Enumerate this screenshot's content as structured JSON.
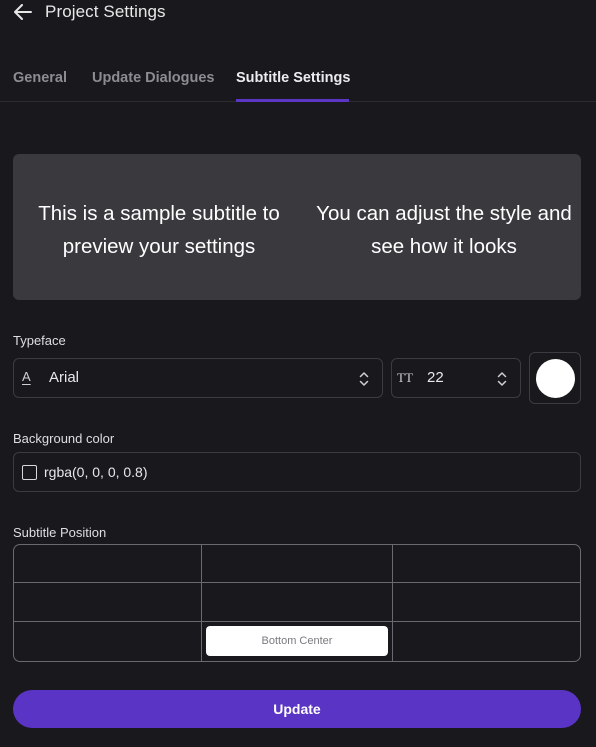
{
  "header": {
    "title": "Project Settings",
    "back_icon": "arrow-left-icon"
  },
  "tabs": [
    {
      "label": "General",
      "active": false
    },
    {
      "label": "Update Dialogues",
      "active": false
    },
    {
      "label": "Subtitle Settings",
      "active": true
    }
  ],
  "preview": {
    "left_text": "This is a sample subtitle to preview your settings",
    "right_text": "You can adjust the style and see how it looks"
  },
  "typeface": {
    "label": "Typeface",
    "font_icon": "A",
    "font_value": "Arial",
    "size_icon": "TT",
    "size_value": "22",
    "text_color": "#ffffff"
  },
  "background": {
    "label": "Background color",
    "value": "rgba(0, 0, 0, 0.8)"
  },
  "position": {
    "label": "Subtitle Position",
    "selected_label": "Bottom Center"
  },
  "actions": {
    "update_label": "Update"
  },
  "colors": {
    "page_bg": "#19181c",
    "accent": "#5a34c4",
    "preview_bg": "#3a3a3e"
  }
}
